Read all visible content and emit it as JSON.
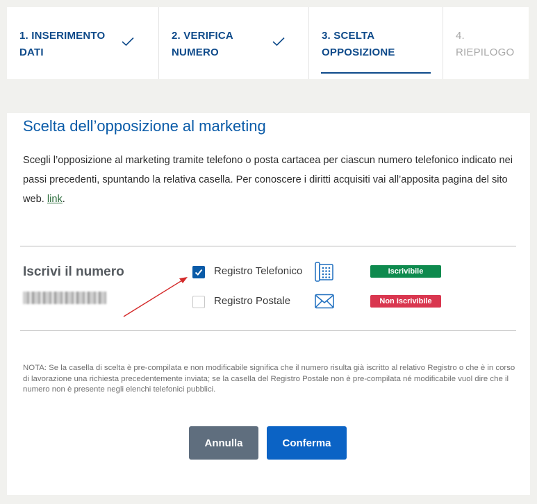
{
  "stepper": {
    "steps": [
      {
        "line1": "1. INSERIMENTO",
        "line2": "DATI",
        "state": "done"
      },
      {
        "line1": "2. VERIFICA",
        "line2": "NUMERO",
        "state": "done"
      },
      {
        "line1": "3. SCELTA",
        "line2": "OPPOSIZIONE",
        "state": "active"
      },
      {
        "line1": "4.",
        "line2": "RIEPILOGO",
        "state": "pending"
      }
    ]
  },
  "card": {
    "title": "Scelta dell’opposizione al marketing",
    "intro_text": "Scegli l’opposizione al marketing tramite telefono o posta cartacea per ciascun numero telefonico indicato nei passi precedenti, spuntando la relativa casella. Per conoscere i diritti acquisiti vai all’apposita pagina del sito web. ",
    "intro_link": "link",
    "intro_end": "."
  },
  "number_section": {
    "title": "Iscrivi il numero",
    "options": [
      {
        "label": "Registro Telefonico",
        "checked": true,
        "icon": "telephone-icon",
        "badge": "Iscrivibile",
        "badge_color": "#0e8a4e"
      },
      {
        "label": "Registro Postale",
        "checked": false,
        "icon": "envelope-icon",
        "badge": "Non iscrivibile",
        "badge_color": "#d9364f"
      }
    ]
  },
  "note": "NOTA: Se la casella di scelta è pre-compilata e non modificabile significa che il numero risulta già iscritto al relativo Registro o che è in corso di lavorazione una richiesta precedentemente inviata; se la casella del Registro Postale non è pre-compilata né modificabile vuol dire che il numero non è presente negli elenchi telefonici pubblici.",
  "buttons": {
    "cancel": "Annulla",
    "confirm": "Conferma"
  },
  "colors": {
    "primary": "#0a5ba8",
    "step_text": "#0e4a8a",
    "cancel_bg": "#5f6e7e",
    "confirm_bg": "#0b63c5",
    "arrow": "#d42a2a"
  }
}
